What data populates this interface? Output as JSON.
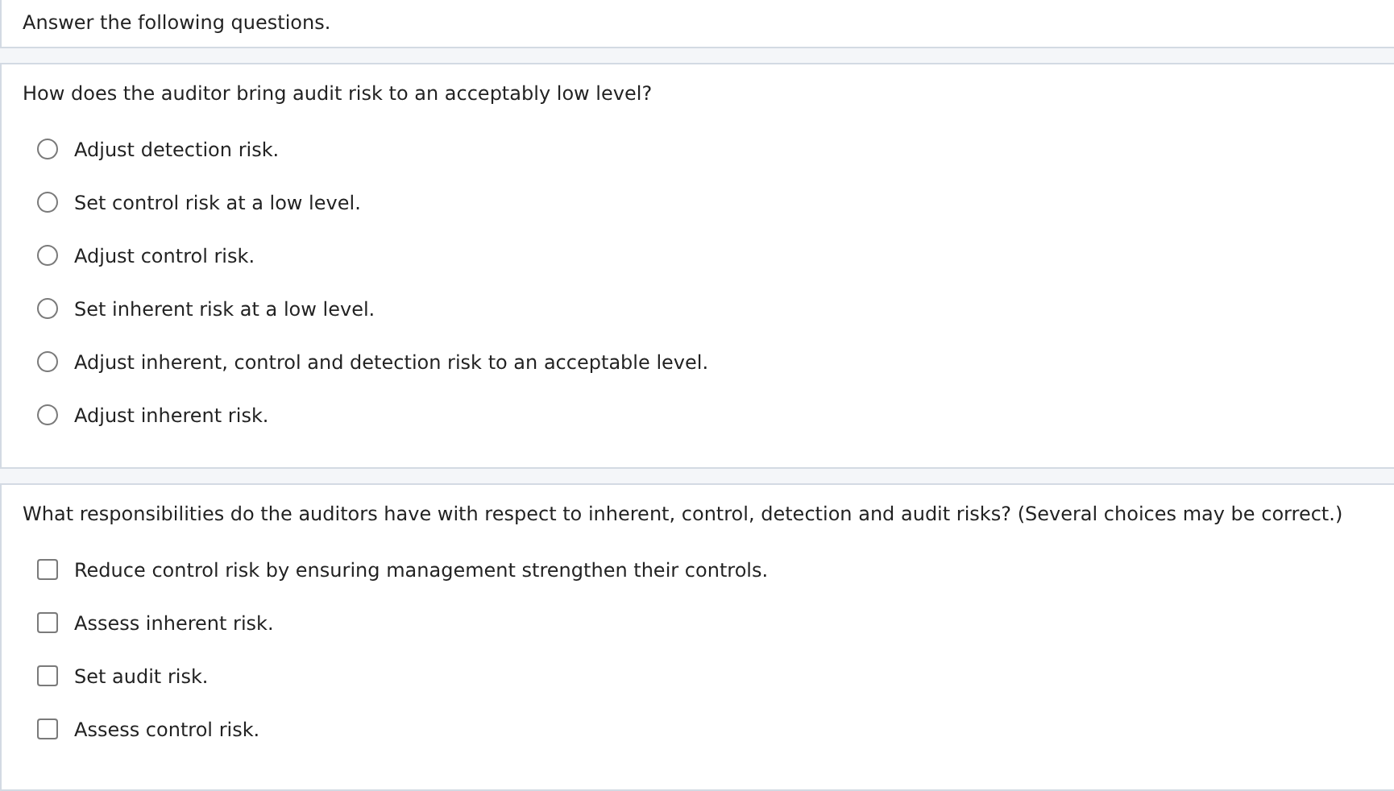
{
  "instructions": "Answer the following questions.",
  "questions": [
    {
      "kind": "radio",
      "prompt": "How does the auditor bring audit risk to an acceptably low level?",
      "options": [
        {
          "label": "Adjust detection risk.",
          "selected": false
        },
        {
          "label": "Set control risk at a low level.",
          "selected": false
        },
        {
          "label": "Adjust control risk.",
          "selected": false
        },
        {
          "label": "Set inherent risk at a low level.",
          "selected": false
        },
        {
          "label": "Adjust inherent, control and detection risk to an acceptable level.",
          "selected": false
        },
        {
          "label": "Adjust inherent risk.",
          "selected": false
        }
      ]
    },
    {
      "kind": "checkbox",
      "prompt": "What responsibilities do the auditors have with respect to inherent, control, detection and audit risks? (Several choices may be correct.)",
      "options": [
        {
          "label": "Reduce control risk by ensuring management strengthen their controls.",
          "checked": false
        },
        {
          "label": "Assess inherent risk.",
          "checked": false
        },
        {
          "label": "Set audit risk.",
          "checked": false
        },
        {
          "label": "Assess control risk.",
          "checked": false
        }
      ]
    }
  ]
}
